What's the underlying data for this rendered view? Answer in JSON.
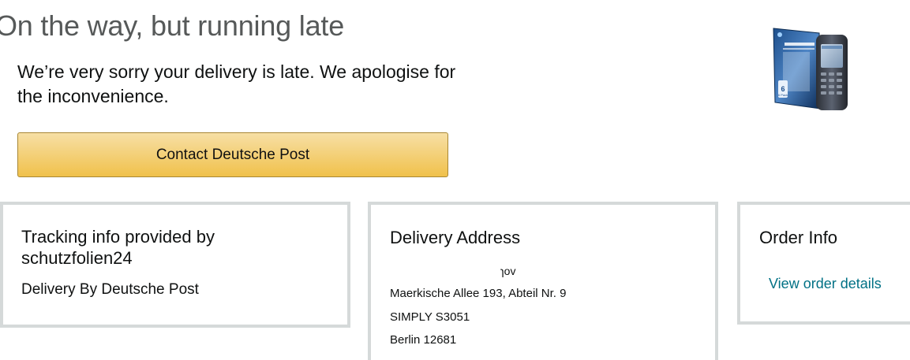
{
  "status": {
    "title": "On the way, but running late",
    "apology": "We’re very sorry your delivery is late. We apologise for the inconvenience.",
    "contact_button_label": "Contact Deutsche Post"
  },
  "product_image": {
    "icon": "screen-protector-and-phone-product-icon",
    "pack_label": "6 Pack"
  },
  "tracking_card": {
    "heading": "Tracking info provided by schutzfolien24",
    "carrier_text": "Delivery By Deutsche Post"
  },
  "address_card": {
    "heading": "Delivery Address",
    "name_fragment": "ɿov",
    "street": "Maerkische Allee 193, Abteil Nr. 9",
    "company": "SIMPLY S3051",
    "city": "Berlin 12681"
  },
  "order_card": {
    "heading": "Order Info",
    "link_label": "View order details"
  },
  "colors": {
    "title_gray": "#565959",
    "button_gradient_top": "#f7dfa5",
    "button_gradient_bottom": "#f0c14b",
    "button_border": "#a88734",
    "card_border": "#d5d9d9",
    "link": "#007185"
  }
}
